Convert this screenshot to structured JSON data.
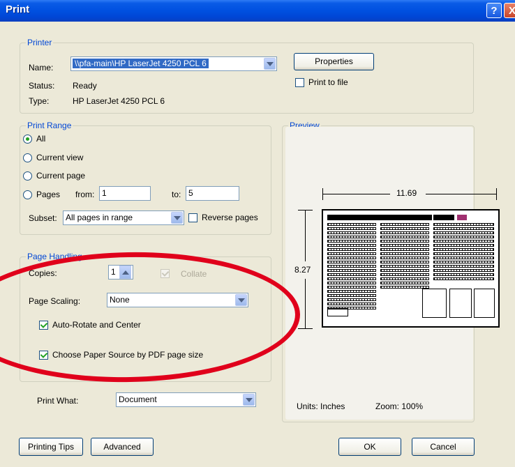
{
  "window": {
    "title": "Print",
    "help_label": "?",
    "close_label": "X"
  },
  "printer": {
    "legend": "Printer",
    "name_label": "Name:",
    "name_value": "\\\\pfa-main\\HP LaserJet 4250 PCL 6",
    "status_label": "Status:",
    "status_value": "Ready",
    "type_label": "Type:",
    "type_value": "HP LaserJet 4250 PCL 6",
    "properties_label": "Properties",
    "print_to_file_label": "Print to file",
    "print_to_file_checked": false
  },
  "print_range": {
    "legend": "Print Range",
    "all_label": "All",
    "current_view_label": "Current view",
    "current_page_label": "Current page",
    "pages_label": "Pages",
    "from_label": "from:",
    "from_value": "1",
    "to_label": "to:",
    "to_value": "5",
    "selected": "All",
    "subset_label": "Subset:",
    "subset_value": "All pages in range",
    "reverse_pages_label": "Reverse pages",
    "reverse_pages_checked": false
  },
  "page_handling": {
    "legend": "Page Handling",
    "copies_label": "Copies:",
    "copies_value": "1",
    "collate_label": "Collate",
    "collate_checked": true,
    "page_scaling_label": "Page Scaling:",
    "page_scaling_value": "None",
    "auto_rotate_label": "Auto-Rotate and Center",
    "auto_rotate_checked": true,
    "paper_source_label": "Choose Paper Source by PDF page size",
    "paper_source_checked": true
  },
  "print_what": {
    "label": "Print What:",
    "value": "Document"
  },
  "preview": {
    "legend": "Preview",
    "width_label": "11.69",
    "height_label": "8.27",
    "units_label": "Units: Inches",
    "zoom_label": "Zoom: 100%"
  },
  "buttons": {
    "printing_tips": "Printing Tips",
    "advanced": "Advanced",
    "ok": "OK",
    "cancel": "Cancel"
  },
  "colors": {
    "title_bar": "#0050e0",
    "legend_text": "#0046d5",
    "annotation_oval": "#e0001b",
    "check_mark": "#21a121"
  }
}
